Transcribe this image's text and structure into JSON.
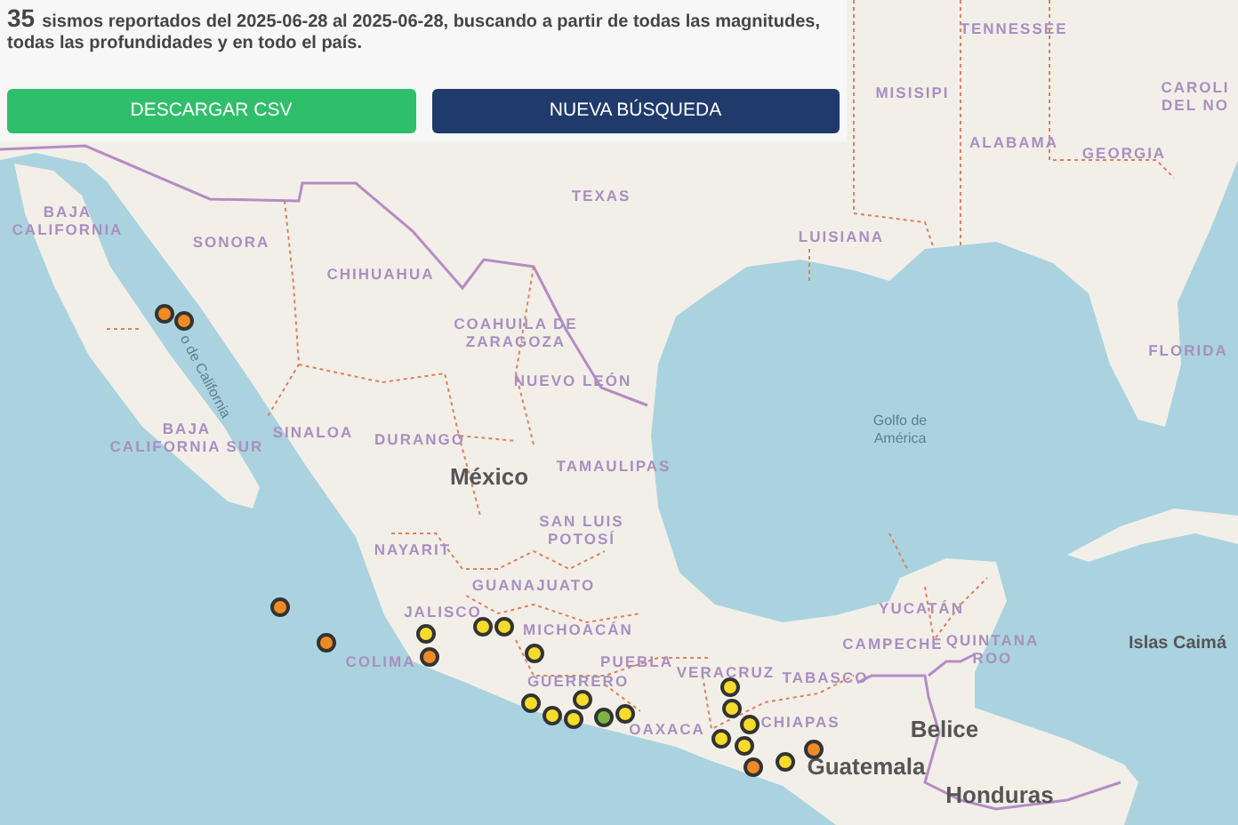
{
  "summary": {
    "count": "35",
    "text": "sismos reportados del 2025-06-28 al 2025-06-28, buscando a partir de todas las magnitudes, todas las profundidades y en todo el país."
  },
  "buttons": [
    {
      "label": "DESCARGAR CSV",
      "kind": "download"
    },
    {
      "label": "NUEVA BÚSQUEDA",
      "kind": "search"
    }
  ],
  "map_labels": [
    {
      "text": "TENNESSEE",
      "kind": "state"
    },
    {
      "text": "MISISIPI",
      "kind": "state"
    },
    {
      "text": "CAROLI\nDEL NO",
      "kind": "state"
    },
    {
      "text": "ALABAMA",
      "kind": "state"
    },
    {
      "text": "GEORGIA",
      "kind": "state"
    },
    {
      "text": "TEXAS",
      "kind": "state"
    },
    {
      "text": "LUISIANA",
      "kind": "state"
    },
    {
      "text": "FLORIDA",
      "kind": "state"
    },
    {
      "text": "BAJA\nCALIFORNIA",
      "kind": "state"
    },
    {
      "text": "SONORA",
      "kind": "state"
    },
    {
      "text": "CHIHUAHUA",
      "kind": "state"
    },
    {
      "text": "COAHUILA DE\nZARAGOZA",
      "kind": "state"
    },
    {
      "text": "NUEVO LEÓN",
      "kind": "state"
    },
    {
      "text": "BAJA\nCALIFORNIA SUR",
      "kind": "state"
    },
    {
      "text": "SINALOA",
      "kind": "state"
    },
    {
      "text": "DURANGO",
      "kind": "state"
    },
    {
      "text": "México",
      "kind": "country"
    },
    {
      "text": "TAMAULIPAS",
      "kind": "state"
    },
    {
      "text": "Golfo de\nAmérica",
      "kind": "water"
    },
    {
      "text": "o de California",
      "kind": "water"
    },
    {
      "text": "NAYARIT",
      "kind": "state"
    },
    {
      "text": "SAN LUIS\nPOTOSÍ",
      "kind": "state"
    },
    {
      "text": "GUANAJUATO",
      "kind": "state"
    },
    {
      "text": "JALISCO",
      "kind": "state"
    },
    {
      "text": "MICHOACÁN",
      "kind": "state"
    },
    {
      "text": "COLIMA",
      "kind": "state"
    },
    {
      "text": "GUERRERO",
      "kind": "state"
    },
    {
      "text": "PUEBLA",
      "kind": "state"
    },
    {
      "text": "VERACRUZ",
      "kind": "state"
    },
    {
      "text": "TABASCO",
      "kind": "state"
    },
    {
      "text": "OAXACA",
      "kind": "state"
    },
    {
      "text": "CHIAPAS",
      "kind": "state"
    },
    {
      "text": "YUCATÁN",
      "kind": "state"
    },
    {
      "text": "CAMPECHE",
      "kind": "state"
    },
    {
      "text": "QUINTANA\nROO",
      "kind": "state"
    },
    {
      "text": "Belice",
      "kind": "country"
    },
    {
      "text": "Guatemala",
      "kind": "country"
    },
    {
      "text": "Honduras",
      "kind": "country"
    },
    {
      "text": "Islas Caimá",
      "kind": "island"
    }
  ],
  "quakes": [
    {
      "color": "#f08a24"
    },
    {
      "color": "#f08a24"
    },
    {
      "color": "#f08a24"
    },
    {
      "color": "#f08a24"
    },
    {
      "color": "#f5dc2a"
    },
    {
      "color": "#f08a24"
    },
    {
      "color": "#f5dc2a"
    },
    {
      "color": "#f5dc2a"
    },
    {
      "color": "#f5dc2a"
    },
    {
      "color": "#f5dc2a"
    },
    {
      "color": "#f5dc2a"
    },
    {
      "color": "#f5dc2a"
    },
    {
      "color": "#f5dc2a"
    },
    {
      "color": "#7cb342"
    },
    {
      "color": "#f5dc2a"
    },
    {
      "color": "#f5dc2a"
    },
    {
      "color": "#f5dc2a"
    },
    {
      "color": "#f5dc2a"
    },
    {
      "color": "#f5dc2a"
    },
    {
      "color": "#f5dc2a"
    },
    {
      "color": "#f08a24"
    },
    {
      "color": "#f5dc2a"
    },
    {
      "color": "#f08a24"
    }
  ]
}
